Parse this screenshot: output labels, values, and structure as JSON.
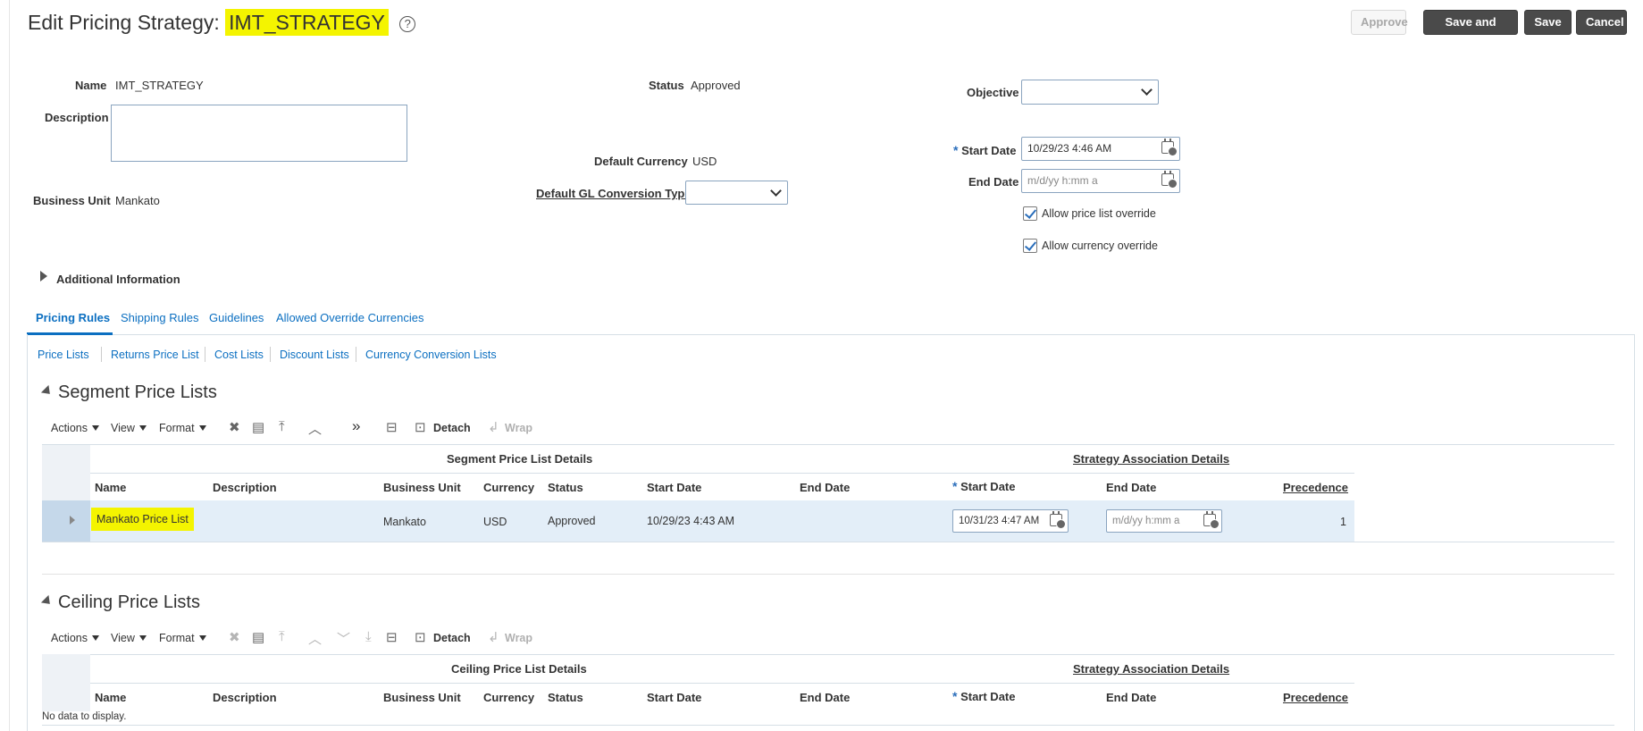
{
  "header": {
    "title_prefix": "Edit Pricing Strategy:",
    "title_name": "IMT_STRATEGY",
    "help_glyph": "?",
    "buttons": {
      "approve": "Approve",
      "save_and_close": "Save and Close",
      "save": "Save",
      "cancel": "Cancel"
    }
  },
  "form": {
    "name_label": "Name",
    "name_value": "IMT_STRATEGY",
    "description_label": "Description",
    "description_value": "",
    "business_unit_label": "Business Unit",
    "business_unit_value": "Mankato",
    "status_label": "Status",
    "status_value": "Approved",
    "default_currency_label": "Default Currency",
    "default_currency_value": "USD",
    "default_gl_label": "Default GL Conversion Type",
    "default_gl_value": "",
    "objective_label": "Objective",
    "objective_value": "",
    "start_date_label": "Start Date",
    "start_date_value": "10/29/23 4:46 AM",
    "end_date_label": "End Date",
    "end_date_placeholder": "m/d/yy h:mm a",
    "allow_price_list_override": "Allow price list override",
    "allow_currency_override": "Allow currency override",
    "required_mark": "*"
  },
  "additional_info": "Additional Information",
  "tabs": [
    "Pricing Rules",
    "Shipping Rules",
    "Guidelines",
    "Allowed Override Currencies"
  ],
  "subtabs": [
    "Price Lists",
    "Returns Price List",
    "Cost Lists",
    "Discount Lists",
    "Currency Conversion Lists"
  ],
  "toolbar": {
    "actions": "Actions",
    "view": "View",
    "format": "Format",
    "detach": "Detach",
    "wrap": "Wrap"
  },
  "segment": {
    "title": "Segment Price Lists",
    "group_left": "Segment Price List Details",
    "group_right": "Strategy Association Details",
    "columns": [
      "Name",
      "Description",
      "Business Unit",
      "Currency",
      "Status",
      "Start Date",
      "End Date",
      "Start Date",
      "End Date",
      "Precedence"
    ],
    "row": {
      "name": "Mankato Price List",
      "description": "",
      "business_unit": "Mankato",
      "currency": "USD",
      "status": "Approved",
      "start_date": "10/29/23 4:43 AM",
      "end_date": "",
      "assoc_start_date": "10/31/23 4:47 AM",
      "assoc_end_date_placeholder": "m/d/yy h:mm a",
      "precedence": "1"
    }
  },
  "ceiling": {
    "title": "Ceiling Price Lists",
    "group_left": "Ceiling Price List Details",
    "group_right": "Strategy Association Details",
    "columns": [
      "Name",
      "Description",
      "Business Unit",
      "Currency",
      "Status",
      "Start Date",
      "End Date",
      "Start Date",
      "End Date",
      "Precedence"
    ],
    "empty": "No data to display."
  }
}
